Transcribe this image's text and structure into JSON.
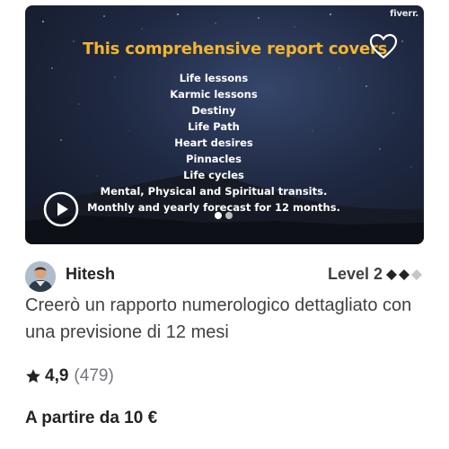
{
  "gig": {
    "watermark": "fiverr.",
    "headline": "This comprehensive report covers",
    "topics": [
      "Life lessons",
      "Karmic lessons",
      "Destiny",
      "Life Path",
      "Heart desires",
      "Pinnacles",
      "Life cycles",
      "Mental, Physical and Spiritual transits.",
      "Monthly and yearly forecast for 12 months."
    ],
    "slides_total": 2,
    "active_slide": 1
  },
  "seller": {
    "name": "Hitesh",
    "level": "Level 2"
  },
  "title": "Creerò un rapporto numerologico dettagliato con una previsione di 12 mesi",
  "rating": {
    "score": "4,9",
    "count": "(479)"
  },
  "price": "A partire da 10 €",
  "colors": {
    "headline": "#f2b431",
    "text_dark": "#222325",
    "text_muted": "#74767e",
    "level_diamond_filled": "#222325",
    "level_diamond_empty": "#c5c6c9"
  },
  "icons": {
    "favorite": "heart-outline-icon",
    "video": "play-icon",
    "rating": "star-icon",
    "level": "diamond-icon"
  }
}
